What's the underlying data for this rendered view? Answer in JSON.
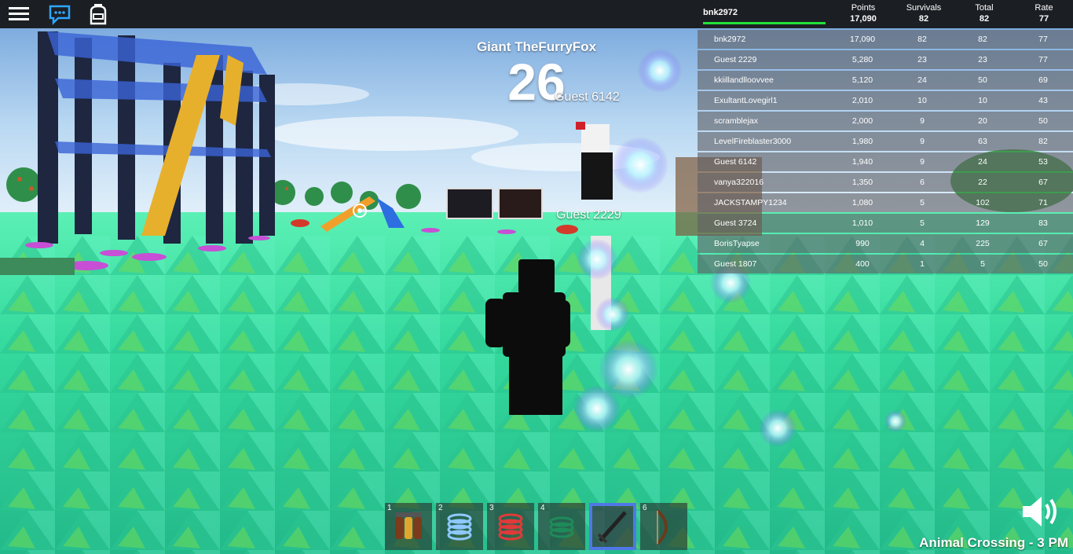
{
  "topbar": {
    "icons": [
      "menu-icon",
      "chat-icon",
      "backpack-icon"
    ]
  },
  "leaderboard": {
    "player_name": "bnk2972",
    "columns": [
      {
        "label": "Points",
        "value": "17,090"
      },
      {
        "label": "Survivals",
        "value": "82"
      },
      {
        "label": "Total",
        "value": "82"
      },
      {
        "label": "Rate",
        "value": "77"
      }
    ],
    "rows": [
      {
        "name": "bnk2972",
        "points": "17,090",
        "survivals": "82",
        "total": "82",
        "rate": "77"
      },
      {
        "name": "Guest 2229",
        "points": "5,280",
        "survivals": "23",
        "total": "23",
        "rate": "77"
      },
      {
        "name": "kkiillandlloovvee",
        "points": "5,120",
        "survivals": "24",
        "total": "50",
        "rate": "69"
      },
      {
        "name": "ExultantLovegirl1",
        "points": "2,010",
        "survivals": "10",
        "total": "10",
        "rate": "43"
      },
      {
        "name": "scramblejax",
        "points": "2,000",
        "survivals": "9",
        "total": "20",
        "rate": "50"
      },
      {
        "name": "LevelFireblaster3000",
        "points": "1,980",
        "survivals": "9",
        "total": "63",
        "rate": "82"
      },
      {
        "name": "Guest 6142",
        "points": "1,940",
        "survivals": "9",
        "total": "24",
        "rate": "53"
      },
      {
        "name": "vanya322016",
        "points": "1,350",
        "survivals": "6",
        "total": "22",
        "rate": "67"
      },
      {
        "name": "JACKSTAMPY1234",
        "points": "1,080",
        "survivals": "5",
        "total": "102",
        "rate": "71"
      },
      {
        "name": "Guest 3724",
        "points": "1,010",
        "survivals": "5",
        "total": "129",
        "rate": "83"
      },
      {
        "name": "BorisTyapse",
        "points": "990",
        "survivals": "4",
        "total": "225",
        "rate": "67"
      },
      {
        "name": "Guest 1807",
        "points": "400",
        "survivals": "1",
        "total": "5",
        "rate": "50"
      }
    ]
  },
  "overlay": {
    "event_title": "Giant TheFurryFox",
    "countdown": "26",
    "nametag_1": "Guest 6142",
    "nametag_2": "Guest 2229"
  },
  "hotbar": {
    "slots": [
      {
        "number": "1",
        "item": "jetpack-icon"
      },
      {
        "number": "2",
        "item": "blue-spring-icon"
      },
      {
        "number": "3",
        "item": "red-coil-icon"
      },
      {
        "number": "4",
        "item": "green-coil-icon"
      },
      {
        "number": "",
        "item": "sword-icon",
        "selected": true
      },
      {
        "number": "6",
        "item": "bow-icon"
      }
    ]
  },
  "music": {
    "now_playing": "Animal Crossing - 3 PM",
    "sound_icon": "speaker-icon"
  },
  "colors": {
    "ground": "#2fd69a",
    "sky": "#9ec9f0",
    "selected_slot": "#4f78e6",
    "health_bar": "#22e03a"
  }
}
